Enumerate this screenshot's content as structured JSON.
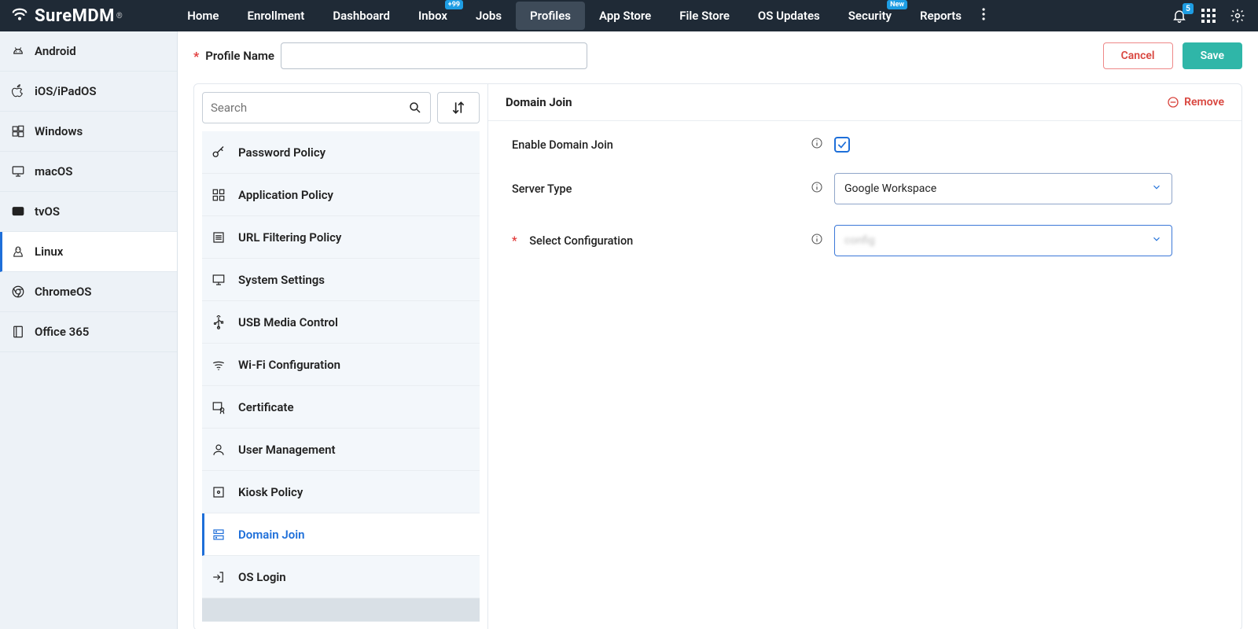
{
  "brand": "SureMDM",
  "nav": {
    "items": [
      "Home",
      "Enrollment",
      "Dashboard",
      "Inbox",
      "Jobs",
      "Profiles",
      "App Store",
      "File Store",
      "OS Updates",
      "Security",
      "Reports"
    ],
    "active": "Profiles",
    "inbox_badge": "+99",
    "security_badge": "New",
    "bell_count": "5"
  },
  "sidebar": {
    "items": [
      "Android",
      "iOS/iPadOS",
      "Windows",
      "macOS",
      "tvOS",
      "Linux",
      "ChromeOS",
      "Office 365"
    ],
    "active": "Linux"
  },
  "profile": {
    "label": "Profile Name",
    "value": "",
    "cancel": "Cancel",
    "save": "Save"
  },
  "search": {
    "placeholder": "Search"
  },
  "policies": {
    "items": [
      "Password Policy",
      "Application Policy",
      "URL Filtering Policy",
      "System Settings",
      "USB Media Control",
      "Wi-Fi Configuration",
      "Certificate",
      "User Management",
      "Kiosk Policy",
      "Domain Join",
      "OS Login"
    ],
    "active": "Domain Join"
  },
  "detail": {
    "title": "Domain Join",
    "remove": "Remove",
    "fields": {
      "enable": "Enable Domain Join",
      "server_type": "Server Type",
      "server_type_value": "Google Workspace",
      "select_config": "Select Configuration",
      "select_config_value": "config"
    }
  }
}
